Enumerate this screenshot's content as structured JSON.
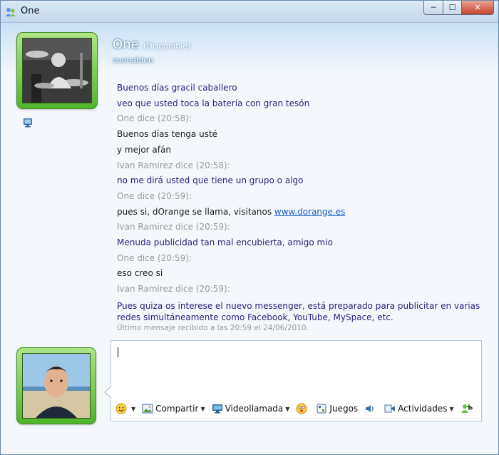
{
  "window": {
    "title": "One",
    "controls": {
      "minimize": "─",
      "maximize": "☐",
      "close": "✕"
    }
  },
  "contact": {
    "name": "One",
    "status": "(Disponible)",
    "personal_message": "suenabien",
    "presence_icon": "computer-icon"
  },
  "conversation": {
    "lines": [
      {
        "kind": "other",
        "text": "Buenos días gracil caballero"
      },
      {
        "kind": "other",
        "text": "veo que usted toca la batería con gran tesón"
      },
      {
        "kind": "sender",
        "text": "One dice (20:58):"
      },
      {
        "kind": "self",
        "text": "Buenos días tenga usté"
      },
      {
        "kind": "self",
        "text": "y mejor afán"
      },
      {
        "kind": "sender",
        "text": "Ivan Ramirez dice (20:58):"
      },
      {
        "kind": "other",
        "text": "no me dirá usted que tiene un grupo o algo"
      },
      {
        "kind": "sender",
        "text": "One dice (20:59):"
      },
      {
        "kind": "self",
        "text": "pues si, dOrange se llama, visitanos ",
        "link": "www.dorange.es"
      },
      {
        "kind": "sender",
        "text": "Ivan Ramirez dice (20:59):"
      },
      {
        "kind": "other",
        "text": "Menuda publicidad tan mal encubierta, amigo mio"
      },
      {
        "kind": "sender",
        "text": "One dice (20:59):"
      },
      {
        "kind": "self",
        "text": "eso creo si"
      },
      {
        "kind": "sender",
        "text": "Ivan Ramirez dice (20:59):"
      },
      {
        "kind": "other",
        "text": "Pues quiza os interese el nuevo messenger, está preparado para publicitar en varias redes simultáneamente como Facebook, YouTube, MySpace, etc."
      }
    ],
    "last_received": "Último mensaje recibido a las 20:59 el 24/06/2010."
  },
  "compose": {
    "value": ""
  },
  "toolbar": {
    "share_label": "Compartir",
    "videocall_label": "Videollamada",
    "games_label": "Juegos",
    "activities_label": "Actividades",
    "overflow": "»"
  },
  "colors": {
    "accent": "#2a227a",
    "link": "#1a5fc6",
    "meta_gray": "#9a9a9a",
    "avatar_frame": "#4fb52a"
  }
}
